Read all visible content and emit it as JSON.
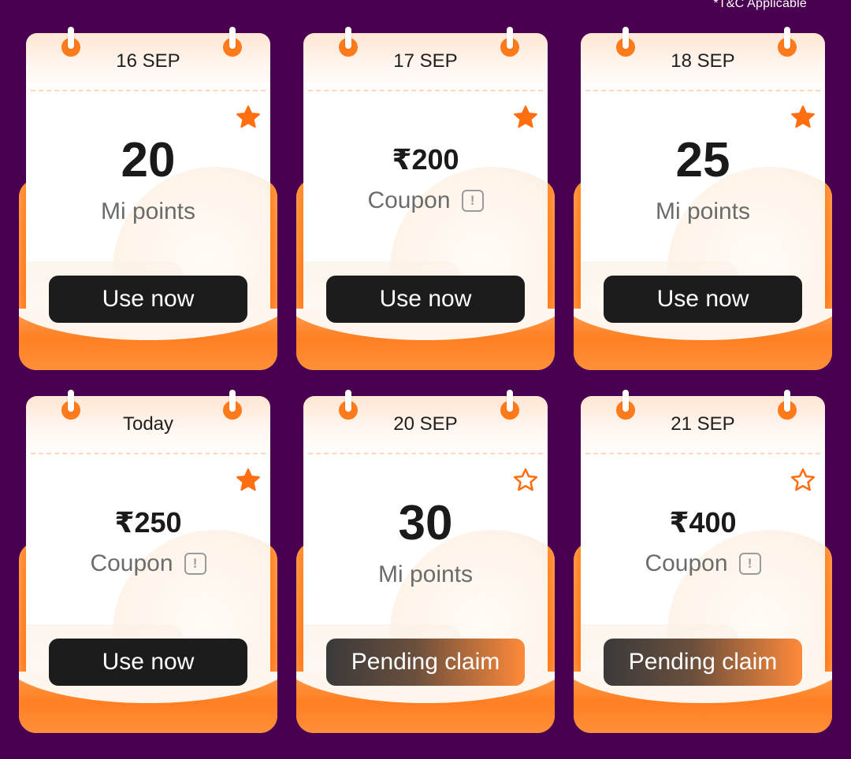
{
  "tnc": "*T&C Applicable",
  "info_glyph": "!",
  "colors": {
    "background": "#4a0050",
    "accent": "#ff7a1a",
    "button": "#1c1c1c"
  },
  "cards": [
    {
      "date": "16 SEP",
      "value": "20",
      "label": "Mi points",
      "kind": "points",
      "star": "filled",
      "button": "Use now",
      "button_state": "use"
    },
    {
      "date": "17 SEP",
      "value": "₹200",
      "label": "Coupon",
      "kind": "coupon",
      "star": "filled",
      "button": "Use now",
      "button_state": "use"
    },
    {
      "date": "18 SEP",
      "value": "25",
      "label": "Mi points",
      "kind": "points",
      "star": "filled",
      "button": "Use now",
      "button_state": "use"
    },
    {
      "date": "Today",
      "value": "₹250",
      "label": "Coupon",
      "kind": "coupon",
      "star": "filled",
      "button": "Use now",
      "button_state": "use"
    },
    {
      "date": "20 SEP",
      "value": "30",
      "label": "Mi points",
      "kind": "points",
      "star": "outline",
      "button": "Pending claim",
      "button_state": "pending"
    },
    {
      "date": "21 SEP",
      "value": "₹400",
      "label": "Coupon",
      "kind": "coupon",
      "star": "outline",
      "button": "Pending claim",
      "button_state": "pending"
    }
  ]
}
